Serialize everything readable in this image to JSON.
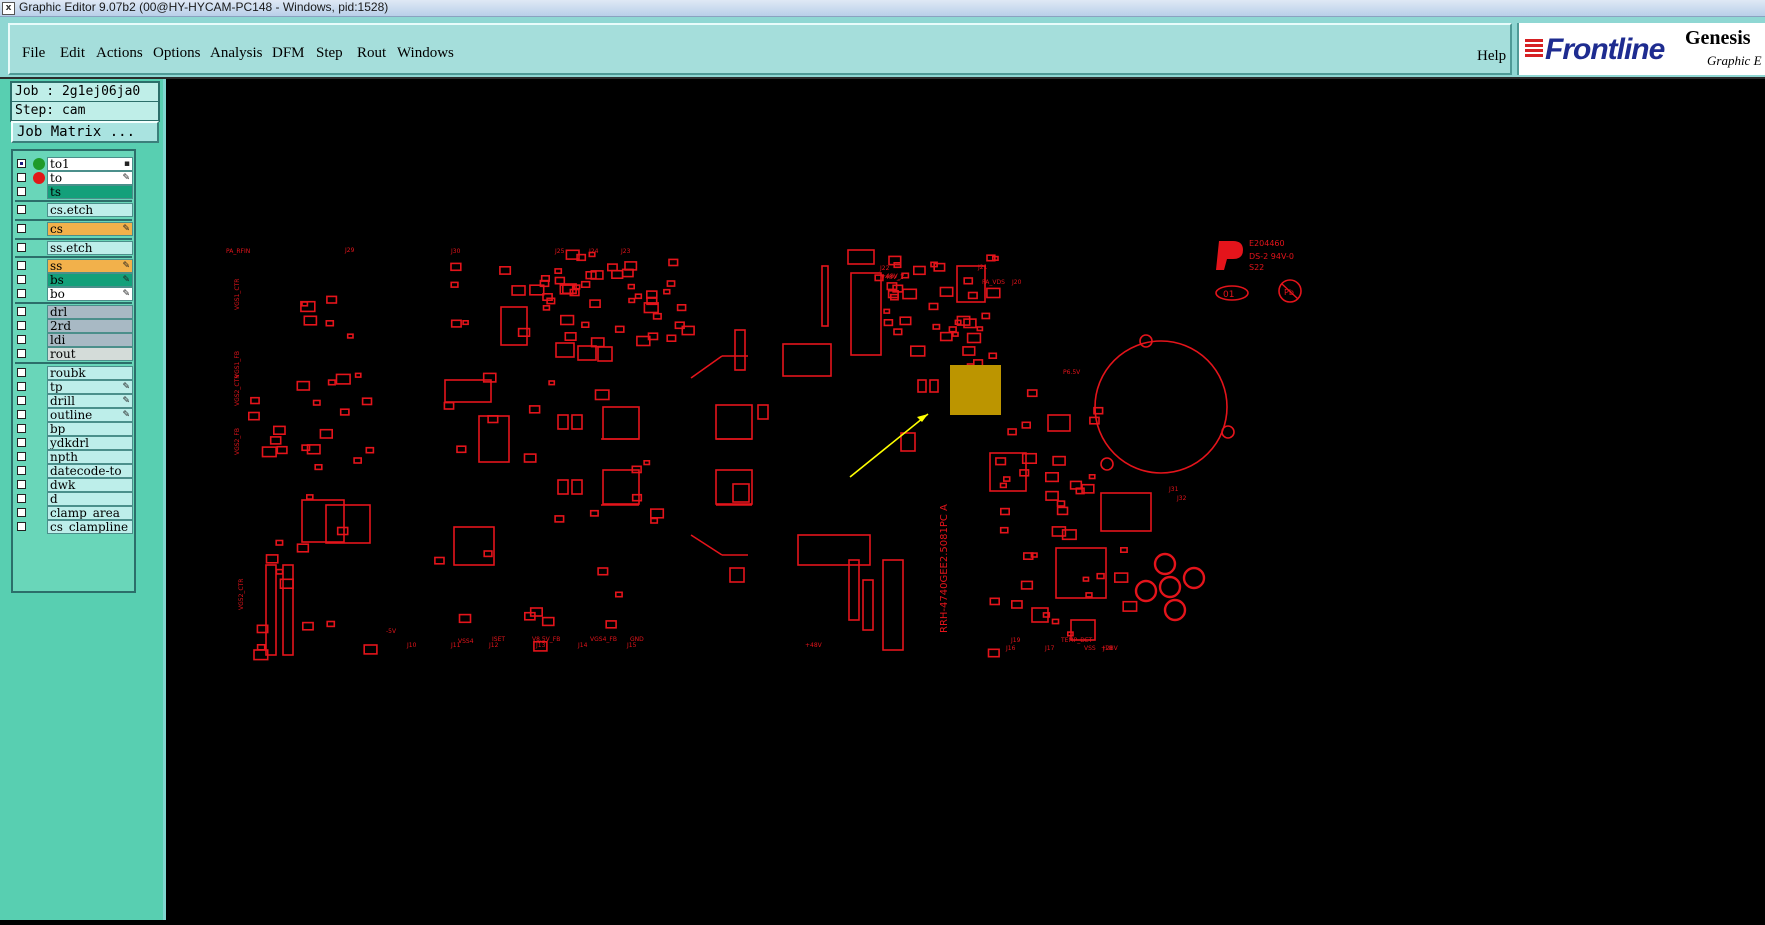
{
  "window": {
    "title": "Graphic Editor 9.07b2 (00@HY-HYCAM-PC148 - Windows, pid:1528)",
    "icon": "x-window-icon"
  },
  "menu": {
    "items": [
      "File",
      "Edit",
      "Actions",
      "Options",
      "Analysis",
      "DFM",
      "Step",
      "Rout",
      "Windows"
    ],
    "help": "Help"
  },
  "logo": {
    "brand": "Frontline",
    "product": "Genesis",
    "subtitle": "Graphic E"
  },
  "job": {
    "job_line": "Job : 2g1ej06ja0",
    "step_line": "Step: cam",
    "matrix_button": "Job Matrix ..."
  },
  "layers": [
    {
      "name": "to1",
      "checked": true,
      "dot": "#1f9a2a",
      "bg": "#ffffff",
      "flag": "▪"
    },
    {
      "name": "to",
      "checked": false,
      "dot": "#e01818",
      "bg": "#ffffff",
      "flag": "✎"
    },
    {
      "name": "ts",
      "checked": false,
      "bg": "#13a07a"
    },
    {
      "name": "cs.etch",
      "checked": false,
      "bg": "#bdeeea"
    },
    {
      "name": "cs",
      "checked": false,
      "bg": "#f2b14b",
      "flag": "✎"
    },
    {
      "name": "ss.etch",
      "checked": false,
      "bg": "#bdeeea"
    },
    {
      "name": "ss",
      "checked": false,
      "bg": "#f2b14b",
      "flag": "✎"
    },
    {
      "name": "bs",
      "checked": false,
      "bg": "#13a07a",
      "flag": "✎"
    },
    {
      "name": "bo",
      "checked": false,
      "bg": "#ffffff",
      "flag": "✎"
    },
    {
      "name": "drl",
      "checked": false,
      "bg": "#a8b9c4"
    },
    {
      "name": "2rd",
      "checked": false,
      "bg": "#a8b9c4"
    },
    {
      "name": "ldi",
      "checked": false,
      "bg": "#a8b9c4"
    },
    {
      "name": "rout",
      "checked": false,
      "bg": "#d4dcd9"
    },
    {
      "name": "roubk",
      "checked": false,
      "bg": "#bdeeea"
    },
    {
      "name": "tp",
      "checked": false,
      "bg": "#bdeeea",
      "flag": "✎"
    },
    {
      "name": "drill",
      "checked": false,
      "bg": "#bdeeea",
      "flag": "✎"
    },
    {
      "name": "outline",
      "checked": false,
      "bg": "#bdeeea",
      "flag": "✎"
    },
    {
      "name": "bp",
      "checked": false,
      "bg": "#bdeeea"
    },
    {
      "name": "ydkdrl",
      "checked": false,
      "bg": "#bdeeea"
    },
    {
      "name": "npth",
      "checked": false,
      "bg": "#bdeeea"
    },
    {
      "name": "datecode-to",
      "checked": false,
      "bg": "#bdeeea"
    },
    {
      "name": "dwk",
      "checked": false,
      "bg": "#bdeeea"
    },
    {
      "name": "d",
      "checked": false,
      "bg": "#bdeeea"
    },
    {
      "name": "clamp_area",
      "checked": false,
      "bg": "#bdeeea"
    },
    {
      "name": "cs_clampline",
      "checked": false,
      "bg": "#bdeeea"
    }
  ],
  "board": {
    "part_number": "RRH-4740GEE2.5081PC A",
    "ul_code": "E204460",
    "ul_rating": "DS-2 94V-0",
    "date_code": "S22",
    "marking_01": "01",
    "pb_mark": "Pb",
    "labels": [
      "PA_RFIN",
      "J29",
      "J30",
      "J25",
      "J24",
      "J23",
      "VGS1_CTR",
      "VGS1_FB",
      "VGS2_CTR",
      "VGS2_FB",
      "VG52_CTR",
      "J22",
      "+48V_1",
      "J21",
      "PA_VDS",
      "J20",
      "+48V_2",
      "J10",
      "J11",
      "J12",
      "J13",
      "J14",
      "J15",
      "J16",
      "J17",
      "J18",
      "J19",
      "TEMP_DET",
      "-5V",
      "VSS4",
      "ISET",
      "V8.5V_FB",
      "VGS4_FB",
      "GND",
      "+48V",
      "P6.5V",
      "J31",
      "J32",
      "+28V",
      "VSS"
    ],
    "trace_color": "#e4141b",
    "pad_color": "#bc9500",
    "arrow_color": "#ffff00"
  }
}
